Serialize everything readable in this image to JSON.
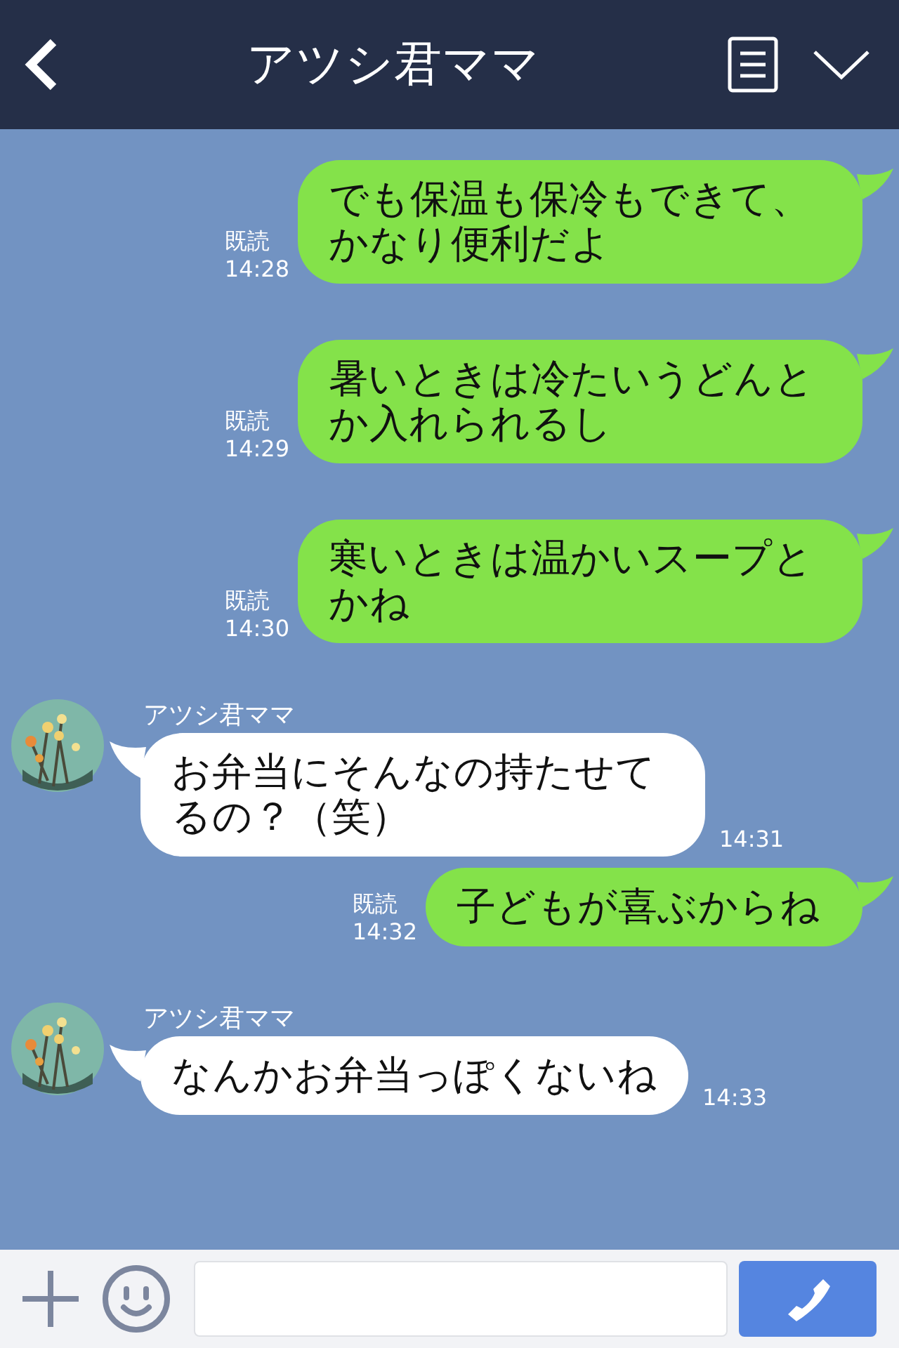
{
  "header": {
    "title": "アツシ君ママ"
  },
  "messages": [
    {
      "kind": "sent",
      "text": "でも保温も保冷もできて、かなり便利だよ",
      "read": "既読",
      "time": "14:28"
    },
    {
      "kind": "sent",
      "text": "暑いときは冷たいうどんとか入れられるし",
      "read": "既読",
      "time": "14:29"
    },
    {
      "kind": "sent",
      "text": "寒いときは温かいスープとかね",
      "read": "既読",
      "time": "14:30"
    },
    {
      "kind": "received",
      "name": "アツシ君ママ",
      "text": "お弁当にそんなの持たせてるの？（笑）",
      "time": "14:31"
    },
    {
      "kind": "sent",
      "text": "子どもが喜ぶからね",
      "read": "既読",
      "time": "14:32"
    },
    {
      "kind": "received",
      "name": "アツシ君ママ",
      "text": "なんかお弁当っぽくないね",
      "time": "14:33"
    }
  ]
}
